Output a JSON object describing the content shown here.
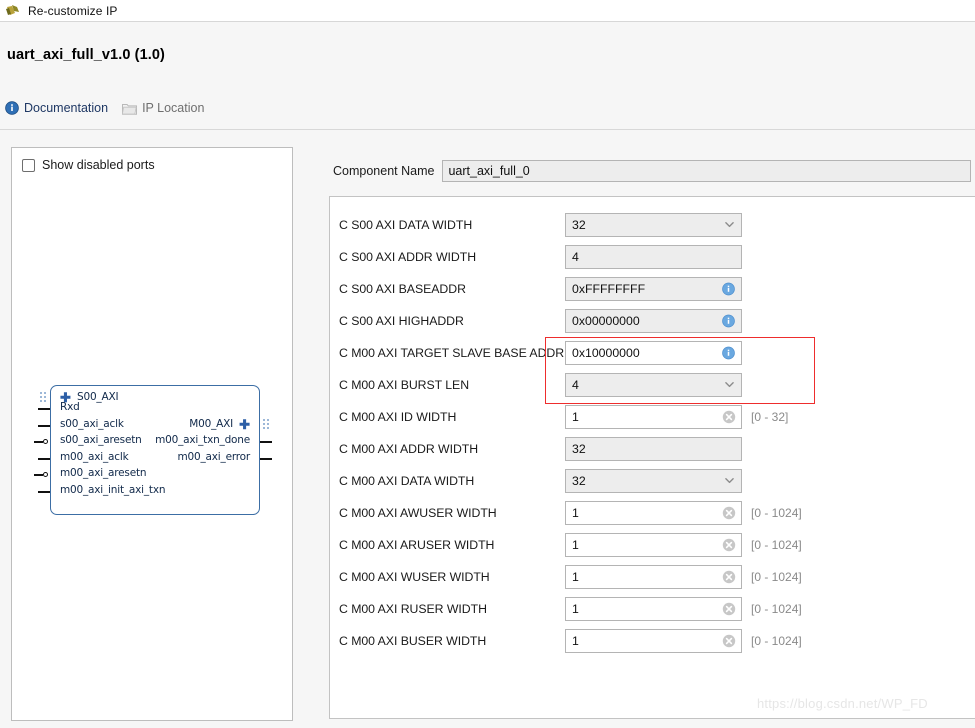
{
  "window": {
    "title": "Re-customize IP",
    "logo_icon": "xilinx-logo-icon"
  },
  "header": {
    "ip_title": "uart_axi_full_v1.0 (1.0)",
    "links": [
      {
        "label": "Documentation",
        "icon": "info-icon"
      },
      {
        "label": "IP Location",
        "icon": "folder-icon"
      }
    ]
  },
  "left_panel": {
    "show_disabled_ports": {
      "label": "Show disabled ports",
      "checked": false
    },
    "block_diagram": {
      "left_ports": [
        {
          "label": "S00_AXI",
          "type": "bus"
        },
        {
          "label": "Rxd",
          "type": "pin"
        },
        {
          "label": "s00_axi_aclk",
          "type": "pin"
        },
        {
          "label": "s00_axi_aresetn",
          "type": "pin-inverted"
        },
        {
          "label": "m00_axi_aclk",
          "type": "pin"
        },
        {
          "label": "m00_axi_aresetn",
          "type": "pin-inverted"
        },
        {
          "label": "m00_axi_init_axi_txn",
          "type": "pin"
        }
      ],
      "right_ports": [
        {
          "label": "M00_AXI",
          "type": "bus"
        },
        {
          "label": "m00_axi_txn_done",
          "type": "pin"
        },
        {
          "label": "m00_axi_error",
          "type": "pin"
        }
      ]
    }
  },
  "component": {
    "label": "Component Name",
    "value": "uart_axi_full_0"
  },
  "fields": [
    {
      "label": "C S00 AXI DATA WIDTH",
      "value": "32",
      "control": "combo",
      "range": ""
    },
    {
      "label": "C S00 AXI ADDR WIDTH",
      "value": "4",
      "control": "plain",
      "range": ""
    },
    {
      "label": "C S00 AXI BASEADDR",
      "value": "0xFFFFFFFF",
      "control": "info",
      "range": ""
    },
    {
      "label": "C S00 AXI HIGHADDR",
      "value": "0x00000000",
      "control": "info",
      "range": ""
    },
    {
      "label": "C M00 AXI TARGET SLAVE BASE ADDR",
      "value": "0x10000000",
      "control": "info-edit",
      "range": ""
    },
    {
      "label": "C M00 AXI BURST LEN",
      "value": "4",
      "control": "combo-edit",
      "range": ""
    },
    {
      "label": "C M00 AXI ID WIDTH",
      "value": "1",
      "control": "clear-edit",
      "range": "[0 - 32]"
    },
    {
      "label": "C M00 AXI ADDR WIDTH",
      "value": "32",
      "control": "plain",
      "range": ""
    },
    {
      "label": "C M00 AXI DATA WIDTH",
      "value": "32",
      "control": "combo",
      "range": ""
    },
    {
      "label": "C M00 AXI AWUSER WIDTH",
      "value": "1",
      "control": "clear-edit",
      "range": "[0 - 1024]"
    },
    {
      "label": "C M00 AXI ARUSER WIDTH",
      "value": "1",
      "control": "clear-edit",
      "range": "[0 - 1024]"
    },
    {
      "label": "C M00 AXI WUSER WIDTH",
      "value": "1",
      "control": "clear-edit",
      "range": "[0 - 1024]"
    },
    {
      "label": "C M00 AXI RUSER WIDTH",
      "value": "1",
      "control": "clear-edit",
      "range": "[0 - 1024]"
    },
    {
      "label": "C M00 AXI BUSER WIDTH",
      "value": "1",
      "control": "clear-edit",
      "range": "[0 - 1024]"
    }
  ],
  "annotation": {
    "highlight_color": "#ee2d2d",
    "highlighted_fields": [
      "C M00 AXI TARGET SLAVE BASE ADDR",
      "C M00 AXI BURST LEN"
    ]
  },
  "watermark": "https://blog.csdn.net/WP_FD"
}
